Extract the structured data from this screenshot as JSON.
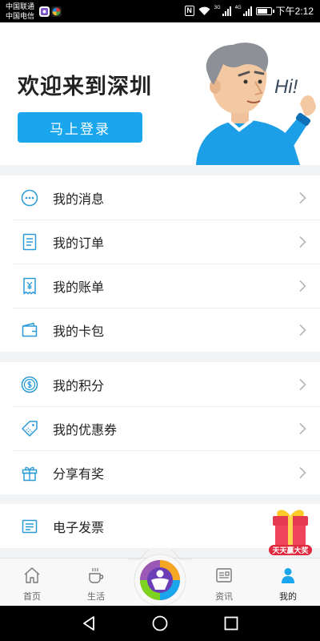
{
  "status_bar": {
    "carrier_1": "中国联通",
    "carrier_2": "中国电信",
    "nfc_label": "N",
    "net_1": "3G",
    "net_2": "4G",
    "time": "下午2:12",
    "battery_level": 0.8
  },
  "header": {
    "welcome": "欢迎来到深圳",
    "login_button": "马上登录",
    "mascot_speech": "Hi!"
  },
  "menu_groups": [
    [
      {
        "label": "我的消息",
        "icon": "message-icon"
      },
      {
        "label": "我的订单",
        "icon": "order-icon"
      },
      {
        "label": "我的账单",
        "icon": "bill-icon"
      },
      {
        "label": "我的卡包",
        "icon": "wallet-icon"
      }
    ],
    [
      {
        "label": "我的积分",
        "icon": "points-icon"
      },
      {
        "label": "我的优惠券",
        "icon": "coupon-icon"
      },
      {
        "label": "分享有奖",
        "icon": "gift-icon"
      }
    ],
    [
      {
        "label": "电子发票",
        "icon": "invoice-icon"
      }
    ]
  ],
  "gift_banner": {
    "label": "天天赢大奖"
  },
  "tabbar": {
    "tabs": [
      {
        "label": "首页",
        "icon": "home-icon"
      },
      {
        "label": "生活",
        "icon": "coffee-icon"
      },
      {
        "label": "资讯",
        "icon": "news-icon"
      },
      {
        "label": "我的",
        "icon": "person-icon",
        "active": true
      }
    ]
  },
  "colors": {
    "accent": "#1aa6ec",
    "icon": "#2a9bd8",
    "background": "#f2f3f5"
  }
}
